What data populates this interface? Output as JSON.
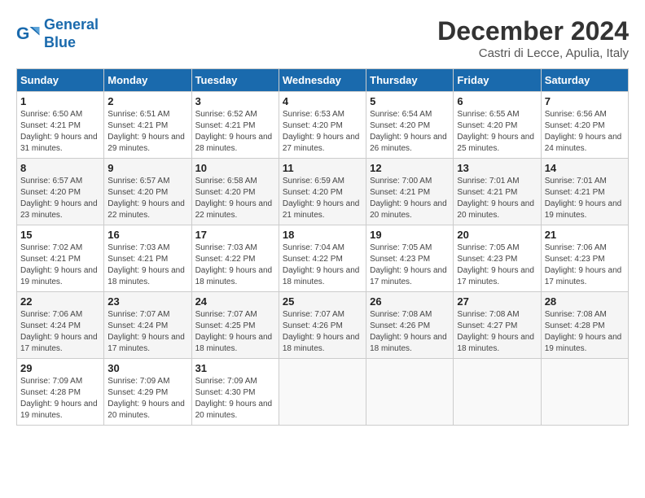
{
  "header": {
    "logo_line1": "General",
    "logo_line2": "Blue",
    "month_title": "December 2024",
    "location": "Castri di Lecce, Apulia, Italy"
  },
  "weekdays": [
    "Sunday",
    "Monday",
    "Tuesday",
    "Wednesday",
    "Thursday",
    "Friday",
    "Saturday"
  ],
  "weeks": [
    [
      {
        "day": "1",
        "info": "Sunrise: 6:50 AM\nSunset: 4:21 PM\nDaylight: 9 hours and 31 minutes."
      },
      {
        "day": "2",
        "info": "Sunrise: 6:51 AM\nSunset: 4:21 PM\nDaylight: 9 hours and 29 minutes."
      },
      {
        "day": "3",
        "info": "Sunrise: 6:52 AM\nSunset: 4:21 PM\nDaylight: 9 hours and 28 minutes."
      },
      {
        "day": "4",
        "info": "Sunrise: 6:53 AM\nSunset: 4:20 PM\nDaylight: 9 hours and 27 minutes."
      },
      {
        "day": "5",
        "info": "Sunrise: 6:54 AM\nSunset: 4:20 PM\nDaylight: 9 hours and 26 minutes."
      },
      {
        "day": "6",
        "info": "Sunrise: 6:55 AM\nSunset: 4:20 PM\nDaylight: 9 hours and 25 minutes."
      },
      {
        "day": "7",
        "info": "Sunrise: 6:56 AM\nSunset: 4:20 PM\nDaylight: 9 hours and 24 minutes."
      }
    ],
    [
      {
        "day": "8",
        "info": "Sunrise: 6:57 AM\nSunset: 4:20 PM\nDaylight: 9 hours and 23 minutes."
      },
      {
        "day": "9",
        "info": "Sunrise: 6:57 AM\nSunset: 4:20 PM\nDaylight: 9 hours and 22 minutes."
      },
      {
        "day": "10",
        "info": "Sunrise: 6:58 AM\nSunset: 4:20 PM\nDaylight: 9 hours and 22 minutes."
      },
      {
        "day": "11",
        "info": "Sunrise: 6:59 AM\nSunset: 4:20 PM\nDaylight: 9 hours and 21 minutes."
      },
      {
        "day": "12",
        "info": "Sunrise: 7:00 AM\nSunset: 4:21 PM\nDaylight: 9 hours and 20 minutes."
      },
      {
        "day": "13",
        "info": "Sunrise: 7:01 AM\nSunset: 4:21 PM\nDaylight: 9 hours and 20 minutes."
      },
      {
        "day": "14",
        "info": "Sunrise: 7:01 AM\nSunset: 4:21 PM\nDaylight: 9 hours and 19 minutes."
      }
    ],
    [
      {
        "day": "15",
        "info": "Sunrise: 7:02 AM\nSunset: 4:21 PM\nDaylight: 9 hours and 19 minutes."
      },
      {
        "day": "16",
        "info": "Sunrise: 7:03 AM\nSunset: 4:21 PM\nDaylight: 9 hours and 18 minutes."
      },
      {
        "day": "17",
        "info": "Sunrise: 7:03 AM\nSunset: 4:22 PM\nDaylight: 9 hours and 18 minutes."
      },
      {
        "day": "18",
        "info": "Sunrise: 7:04 AM\nSunset: 4:22 PM\nDaylight: 9 hours and 18 minutes."
      },
      {
        "day": "19",
        "info": "Sunrise: 7:05 AM\nSunset: 4:23 PM\nDaylight: 9 hours and 17 minutes."
      },
      {
        "day": "20",
        "info": "Sunrise: 7:05 AM\nSunset: 4:23 PM\nDaylight: 9 hours and 17 minutes."
      },
      {
        "day": "21",
        "info": "Sunrise: 7:06 AM\nSunset: 4:23 PM\nDaylight: 9 hours and 17 minutes."
      }
    ],
    [
      {
        "day": "22",
        "info": "Sunrise: 7:06 AM\nSunset: 4:24 PM\nDaylight: 9 hours and 17 minutes."
      },
      {
        "day": "23",
        "info": "Sunrise: 7:07 AM\nSunset: 4:24 PM\nDaylight: 9 hours and 17 minutes."
      },
      {
        "day": "24",
        "info": "Sunrise: 7:07 AM\nSunset: 4:25 PM\nDaylight: 9 hours and 18 minutes."
      },
      {
        "day": "25",
        "info": "Sunrise: 7:07 AM\nSunset: 4:26 PM\nDaylight: 9 hours and 18 minutes."
      },
      {
        "day": "26",
        "info": "Sunrise: 7:08 AM\nSunset: 4:26 PM\nDaylight: 9 hours and 18 minutes."
      },
      {
        "day": "27",
        "info": "Sunrise: 7:08 AM\nSunset: 4:27 PM\nDaylight: 9 hours and 18 minutes."
      },
      {
        "day": "28",
        "info": "Sunrise: 7:08 AM\nSunset: 4:28 PM\nDaylight: 9 hours and 19 minutes."
      }
    ],
    [
      {
        "day": "29",
        "info": "Sunrise: 7:09 AM\nSunset: 4:28 PM\nDaylight: 9 hours and 19 minutes."
      },
      {
        "day": "30",
        "info": "Sunrise: 7:09 AM\nSunset: 4:29 PM\nDaylight: 9 hours and 20 minutes."
      },
      {
        "day": "31",
        "info": "Sunrise: 7:09 AM\nSunset: 4:30 PM\nDaylight: 9 hours and 20 minutes."
      },
      null,
      null,
      null,
      null
    ]
  ]
}
